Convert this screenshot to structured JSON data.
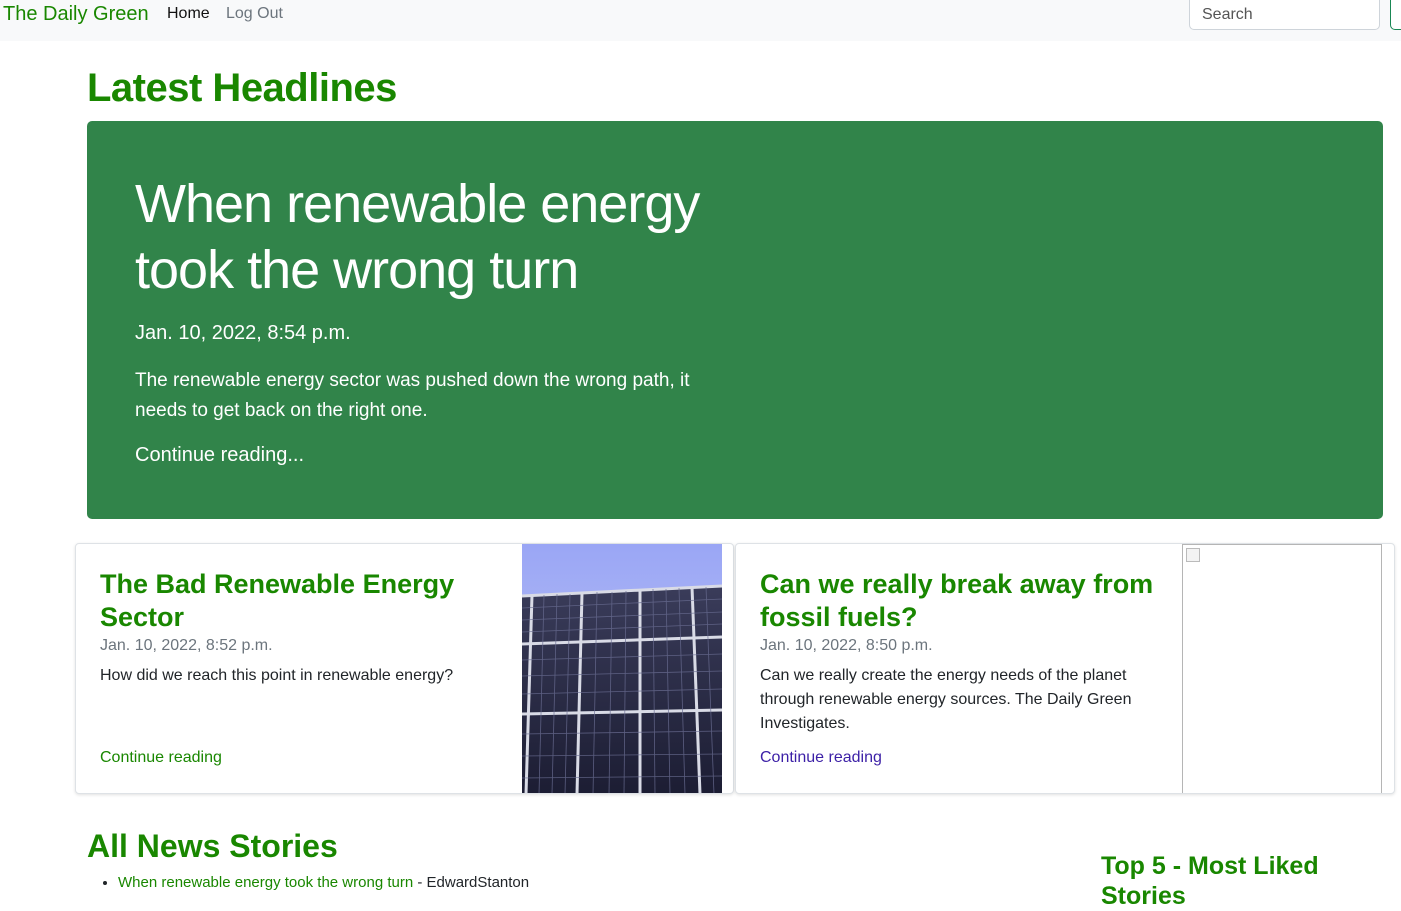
{
  "navbar": {
    "brand": "The Daily Green",
    "links": [
      "Home",
      "Log Out"
    ],
    "search_placeholder": "Search"
  },
  "latest": {
    "heading": "Latest Headlines",
    "featured": {
      "title": "When renewable energy took the wrong turn",
      "date": "Jan. 10, 2022, 8:54 p.m.",
      "lead": "The renewable energy sector was pushed down the wrong path, it needs to get back on the right one.",
      "continue": "Continue reading..."
    },
    "cards": [
      {
        "title": "The Bad Renewable Energy Sector",
        "date": "Jan. 10, 2022, 8:52 p.m.",
        "text": "How did we reach this point in renewable energy?",
        "link": "Continue reading",
        "image": "solar-panels-image"
      },
      {
        "title": "Can we really break away from fossil fuels?",
        "date": "Jan. 10, 2022, 8:50 p.m.",
        "text": "Can we really create the energy needs of the planet through renewable energy sources. The Daily Green Investigates.",
        "link": "Continue reading",
        "image": "broken-image-icon"
      }
    ]
  },
  "all_stories": {
    "heading": "All News Stories",
    "items": [
      {
        "title": "When renewable energy took the wrong turn",
        "separator": " - ",
        "author": "EdwardStanton"
      }
    ]
  },
  "sidebar": {
    "heading": "Top 5 - Most Liked Stories"
  },
  "colors": {
    "brand_green": "#198700",
    "hero_bg": "#31844a",
    "visited_link": "#3b1fa6"
  }
}
